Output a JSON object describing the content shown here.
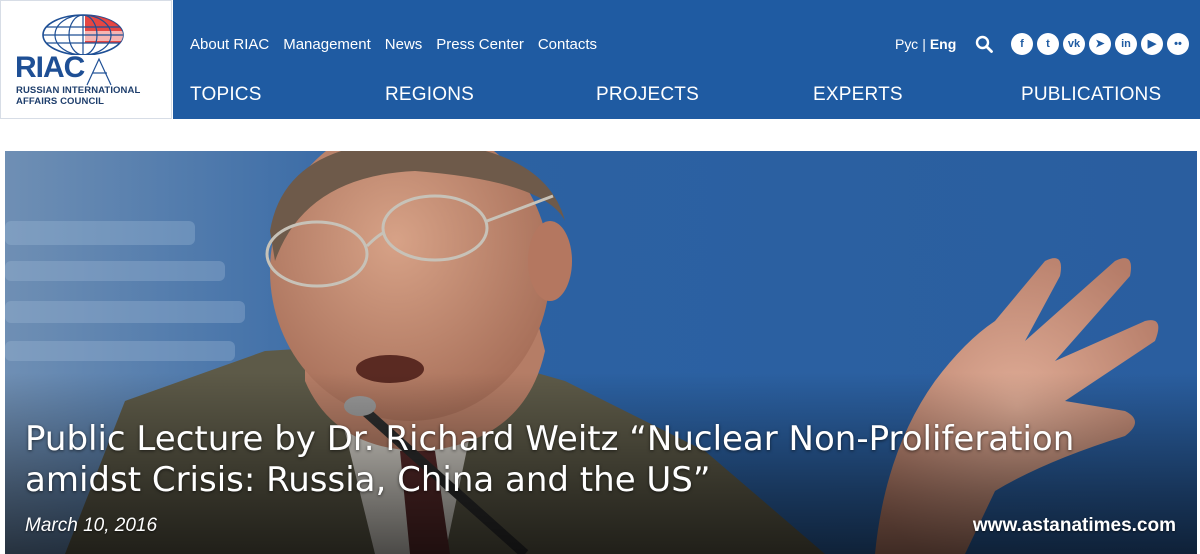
{
  "logo": {
    "acronym": "RIAC",
    "line1": "Russian International",
    "line2": "Affairs Council"
  },
  "topnav": [
    "About RIAC",
    "Management",
    "News",
    "Press Center",
    "Contacts"
  ],
  "lang": {
    "ru": "Рус",
    "en": "Eng",
    "active": "Eng"
  },
  "social": [
    {
      "icon": "facebook-icon",
      "glyph": "f"
    },
    {
      "icon": "twitter-icon",
      "glyph": "t"
    },
    {
      "icon": "vk-icon",
      "glyph": "vk"
    },
    {
      "icon": "telegram-icon",
      "glyph": "➤"
    },
    {
      "icon": "linkedin-icon",
      "glyph": "in"
    },
    {
      "icon": "youtube-icon",
      "glyph": "▶"
    },
    {
      "icon": "flickr-icon",
      "glyph": "••"
    }
  ],
  "mainnav": [
    "TOPICS",
    "REGIONS",
    "PROJECTS",
    "EXPERTS",
    "PUBLICATIONS"
  ],
  "hero": {
    "title": "Public Lecture by Dr. Richard Weitz “Nuclear Non-Proliferation amidst Crisis: Russia, China and the US”",
    "date": "March 10, 2016",
    "source": "www.astanatimes.com"
  },
  "colors": {
    "brand_blue": "#1f5ba2",
    "logo_red": "#e3332f",
    "logo_blue": "#1e4f95"
  }
}
